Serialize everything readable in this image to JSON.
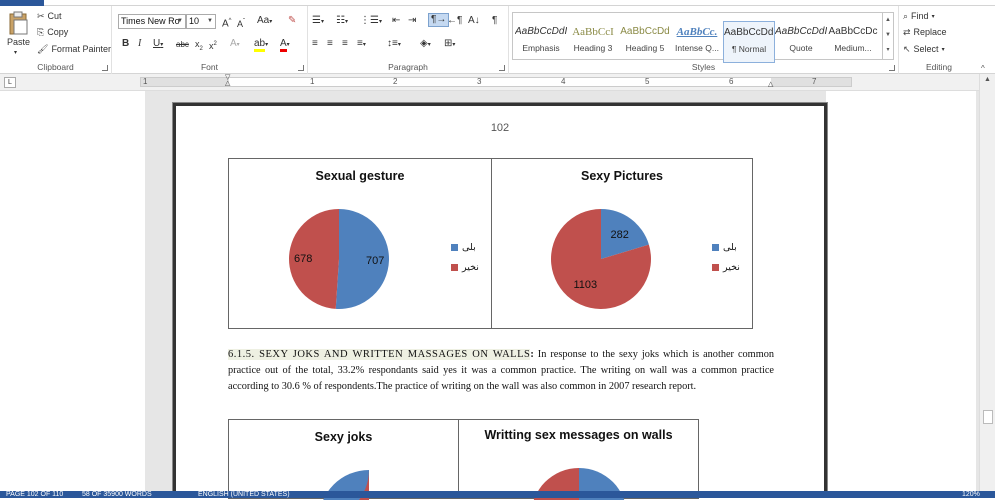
{
  "ribbon": {
    "clipboard": {
      "paste": "Paste",
      "cut": "Cut",
      "copy": "Copy",
      "format_painter": "Format Painter",
      "label": "Clipboard"
    },
    "font": {
      "name": "Times New Ro",
      "size": "10",
      "label": "Font"
    },
    "paragraph": {
      "label": "Paragraph"
    },
    "styles": {
      "label": "Styles",
      "items": [
        {
          "preview": "AaBbCcDdI",
          "name": "Emphasis"
        },
        {
          "preview": "AaBbCcI",
          "name": "Heading 3"
        },
        {
          "preview": "AaBbCcDd",
          "name": "Heading 5"
        },
        {
          "preview": "AaBbCc.",
          "name": "Intense Q..."
        },
        {
          "preview": "AaBbCcDdI",
          "name": "¶ Normal"
        },
        {
          "preview": "AaBbCcDdI",
          "name": "Quote"
        },
        {
          "preview": "AaBbCcDc",
          "name": "Medium..."
        }
      ]
    },
    "editing": {
      "find": "Find",
      "replace": "Replace",
      "select": "Select",
      "label": "Editing"
    }
  },
  "ruler": {
    "numbers": [
      "1",
      "1",
      "2",
      "3",
      "4",
      "5",
      "6",
      "7"
    ]
  },
  "page": {
    "number": "102",
    "body": {
      "heading": "6.1.5. SEXY JOKS AND WRITTEN MASSAGES ON WALLS",
      "colon": ":",
      "text": " In response to the sexy joks which is another common practice out of the total, 33.2% respondants said yes it was a common practice. The writing on wall was a common practice according to 30.6 % of respondents.The practice of writing on the wall was also common in 2007 research report."
    }
  },
  "colors": {
    "yes": "#4f81bd",
    "no": "#c0504d",
    "ribbon_blue": "#2b579a"
  },
  "chart_data": [
    {
      "type": "pie",
      "title": "Sexual gesture",
      "labels": [
        "بلی",
        "نخير"
      ],
      "values": [
        707,
        678
      ]
    },
    {
      "type": "pie",
      "title": "Sexy Pictures",
      "labels": [
        "بلی",
        "نخير"
      ],
      "values": [
        282,
        1103
      ]
    },
    {
      "type": "pie",
      "title": "Sexy joks",
      "labels": [],
      "values": []
    },
    {
      "type": "pie",
      "title": "Writting sex messages on walls",
      "labels": [],
      "values": []
    }
  ],
  "status": {
    "page": "PAGE 102 OF 110",
    "words": "58 OF 35900 WORDS",
    "language": "ENGLISH (UNITED STATES)",
    "zoom": "120%"
  }
}
